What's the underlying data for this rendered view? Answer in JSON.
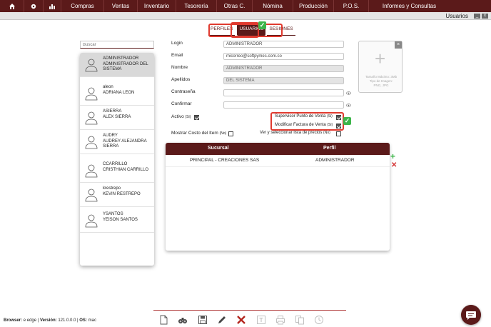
{
  "menu": {
    "items": [
      "Compras",
      "Ventas",
      "Inventario",
      "Tesorería",
      "Otras C.",
      "Nómina",
      "Producción",
      "P.O.S.",
      "Informes y Consultas"
    ]
  },
  "window": {
    "title": "Usuarios",
    "minimize": "_",
    "close": "x"
  },
  "tabs": [
    "PERFILES",
    "USUARIOS",
    "SESIONES"
  ],
  "search": {
    "placeholder": "Buscar"
  },
  "users": [
    {
      "line1": "ADMINISTRADOR",
      "line2": "ADMINISTRADOR DEL",
      "line3": "SISTEMA"
    },
    {
      "line1": "aleon",
      "line2": "ADRIANA LEON",
      "line3": ""
    },
    {
      "line1": "ASIERRA",
      "line2": "ALEX SIERRA",
      "line3": ""
    },
    {
      "line1": "AUDRY",
      "line2": "AUDREY ALEJANDRA",
      "line3": "SIERRA"
    },
    {
      "line1": "CCARRILLO",
      "line2": "CRISTHIAN CARRILLO",
      "line3": ""
    },
    {
      "line1": "krestrepo",
      "line2": "KEVIN RESTREPO",
      "line3": ""
    },
    {
      "line1": "YSANTOS",
      "line2": "YEISON SANTOS",
      "line3": ""
    }
  ],
  "form": {
    "login_label": "Login",
    "login_value": "ADMINISTRADOR",
    "email_label": "Email",
    "email_value": "micorreo@softpymes.com.co",
    "nombre_label": "Nombre",
    "nombre_value": "ADMINISTRADOR",
    "apellidos_label": "Apellidos",
    "apellidos_value": "DEL SISTEMA",
    "password_label": "Contraseña",
    "confirm_label": "Confirmar",
    "activo_label": "Activo",
    "activo_hint": "(Si)",
    "supervisor_label": "Supervisor Punto de Venta",
    "supervisor_hint": "(Si)",
    "modificar_label": "Modificar Factura de Venta",
    "modificar_hint": "(Si)",
    "mostrar_label": "Mostrar Costo del Item",
    "mostrar_hint": "(No)",
    "ver_label": "Ver y seleccionar lista de precios",
    "ver_hint": "(No)"
  },
  "image": {
    "caption1": "Tamaño Máximo: 3Mb",
    "caption2": "Tipo de Imagen:",
    "caption3": "PNG, JPG"
  },
  "grid": {
    "headers": [
      "Sucursal",
      "Perfil"
    ],
    "rows": [
      {
        "sucursal": "PRINCIPAL - CREACIONES SAS",
        "perfil": "ADMINISTRADOR"
      }
    ]
  },
  "footer": {
    "browser_label": "Browser:",
    "browser_value": "edge",
    "version_label": "Versión:",
    "version_value": "121.0.0.0",
    "os_label": "OS:",
    "os_value": "mac"
  },
  "icons": {
    "menu": [
      "home-icon",
      "gear-icon",
      "bar-chart-icon"
    ],
    "toolbar": [
      "new-icon",
      "search-binoculars-icon",
      "save-icon",
      "edit-icon",
      "delete-icon",
      "text-icon",
      "print-icon",
      "copy-icon",
      "history-icon"
    ]
  },
  "colors": {
    "brand": "#5b1a1a",
    "highlight": "#e03a2f",
    "check": "#3db54a",
    "delete": "#d32f2f"
  }
}
